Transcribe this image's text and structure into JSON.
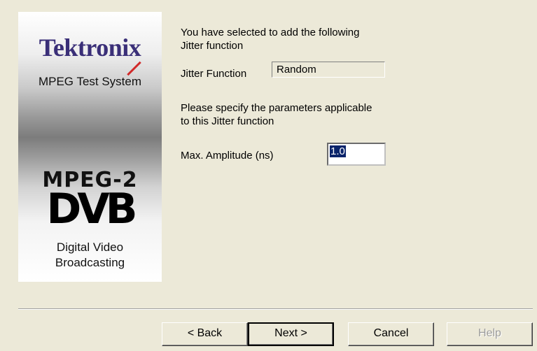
{
  "banner": {
    "brand": "Tektronix",
    "subtitle": "MPEG Test System",
    "mpeg_logo": "MPEG-2",
    "dvb_logo": "DVB",
    "dvb_line1": "Digital Video",
    "dvb_line2": "Broadcasting"
  },
  "intro": {
    "line1": "You have selected to add the following",
    "line2": "Jitter function"
  },
  "jitter_function": {
    "label": "Jitter Function",
    "value": "Random"
  },
  "params": {
    "line1": "Please specify the parameters applicable",
    "line2": "to this Jitter function"
  },
  "max_amplitude": {
    "label": "Max. Amplitude (ns)",
    "value": "1.0"
  },
  "buttons": {
    "back": "< Back",
    "next": "Next >",
    "cancel": "Cancel",
    "help": "Help"
  }
}
